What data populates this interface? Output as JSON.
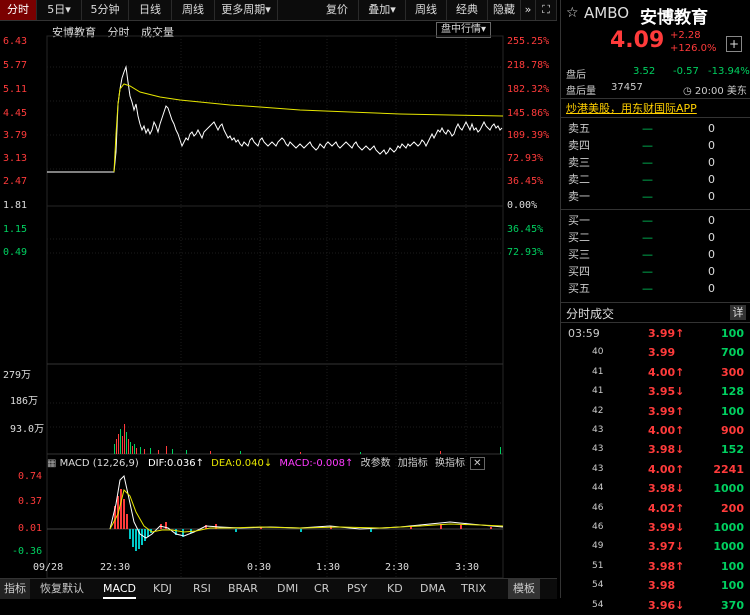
{
  "toolbar": {
    "tabs": [
      "分时",
      "5日▾",
      "5分钟",
      "日线",
      "周线",
      "更多周期▾"
    ],
    "right_tabs": [
      "复价",
      "叠加▾",
      "周线",
      "经典",
      "隐藏"
    ],
    "right_icons": [
      "chevron-double-right-icon",
      "expand-icon"
    ]
  },
  "chart_header": {
    "name": "安博教育",
    "mode": "分时",
    "volume_label": "成交量",
    "dropdown": "盘中行情▾"
  },
  "price_axis": {
    "left": [
      "6.43",
      "5.77",
      "5.11",
      "4.45",
      "3.79",
      "3.13",
      "2.47",
      "1.81",
      "1.15",
      "0.49"
    ],
    "right": [
      "255.25%",
      "218.78%",
      "182.32%",
      "145.86%",
      "109.39%",
      "72.93%",
      "36.45%",
      "0.00%",
      "36.45%",
      "72.93%"
    ]
  },
  "volume_axis": [
    "279万",
    "186万",
    "93.0万"
  ],
  "macd_header": {
    "title": "MACD (12,26,9)",
    "dif": "DIF:0.036↑",
    "dea": "DEA:0.040↓",
    "macd": "MACD:-0.008↑",
    "change_params": "改参数",
    "add_indicator": "加指标",
    "swap_indicator": "换指标"
  },
  "macd_axis": [
    "0.74",
    "0.37",
    "0.01",
    "-0.36"
  ],
  "time_axis": [
    "09/28",
    "22:30",
    "0:30",
    "1:30",
    "2:30",
    "3:30"
  ],
  "bottom_tabs": [
    "指标",
    "恢复默认",
    "MACD",
    "KDJ",
    "RSI",
    "BRAR",
    "DMI",
    "CR",
    "PSY",
    "KD",
    "DMA",
    "TRIX",
    "模板"
  ],
  "quote": {
    "symbol": "AMBO",
    "name": "安博教育",
    "price": "4.09",
    "change": "+2.28",
    "change_pct": "+126.0%",
    "after_hours_label": "盘后",
    "after_hours_price": "3.52",
    "after_hours_change": "-0.57",
    "after_hours_pct": "-13.94%",
    "after_vol_label": "盘后量",
    "after_vol": "37457",
    "time_note": "◷ 20:00 美东",
    "promo": "炒港美股，用东财国际APP"
  },
  "order_book": {
    "asks": [
      {
        "label": "卖五",
        "price": "—",
        "vol": "0"
      },
      {
        "label": "卖四",
        "price": "—",
        "vol": "0"
      },
      {
        "label": "卖三",
        "price": "—",
        "vol": "0"
      },
      {
        "label": "卖二",
        "price": "—",
        "vol": "0"
      },
      {
        "label": "卖一",
        "price": "—",
        "vol": "0"
      }
    ],
    "bids": [
      {
        "label": "买一",
        "price": "—",
        "vol": "0"
      },
      {
        "label": "买二",
        "price": "—",
        "vol": "0"
      },
      {
        "label": "买三",
        "price": "—",
        "vol": "0"
      },
      {
        "label": "买四",
        "price": "—",
        "vol": "0"
      },
      {
        "label": "买五",
        "price": "—",
        "vol": "0"
      }
    ]
  },
  "ticks_header": {
    "title": "分时成交",
    "detail": "详"
  },
  "ticks": [
    {
      "t": "03:59",
      "p": "3.99↑",
      "v": "100",
      "pc": "red",
      "vc": "green"
    },
    {
      "t": "40",
      "p": "3.99",
      "v": "700",
      "pc": "red",
      "vc": "green"
    },
    {
      "t": "41",
      "p": "4.00↑",
      "v": "300",
      "pc": "red",
      "vc": "red"
    },
    {
      "t": "41",
      "p": "3.95↓",
      "v": "128",
      "pc": "red",
      "vc": "green"
    },
    {
      "t": "42",
      "p": "3.99↑",
      "v": "100",
      "pc": "red",
      "vc": "green"
    },
    {
      "t": "43",
      "p": "4.00↑",
      "v": "900",
      "pc": "red",
      "vc": "red"
    },
    {
      "t": "43",
      "p": "3.98↓",
      "v": "152",
      "pc": "red",
      "vc": "green"
    },
    {
      "t": "43",
      "p": "4.00↑",
      "v": "2241",
      "pc": "red",
      "vc": "red"
    },
    {
      "t": "44",
      "p": "3.98↓",
      "v": "1000",
      "pc": "red",
      "vc": "green"
    },
    {
      "t": "46",
      "p": "4.02↑",
      "v": "200",
      "pc": "red",
      "vc": "red"
    },
    {
      "t": "46",
      "p": "3.99↓",
      "v": "1000",
      "pc": "red",
      "vc": "green"
    },
    {
      "t": "49",
      "p": "3.97↓",
      "v": "1000",
      "pc": "red",
      "vc": "green"
    },
    {
      "t": "51",
      "p": "3.98↑",
      "v": "100",
      "pc": "red",
      "vc": "green"
    },
    {
      "t": "54",
      "p": "3.98",
      "v": "100",
      "pc": "red",
      "vc": "green"
    },
    {
      "t": "54",
      "p": "3.96↓",
      "v": "370",
      "pc": "red",
      "vc": "green"
    }
  ],
  "colors": {
    "up": "#ff3b3b",
    "down": "#00d060",
    "avg_line": "#e6e600",
    "price_line": "#ffffff",
    "accent_bg": "#7a0000"
  }
}
